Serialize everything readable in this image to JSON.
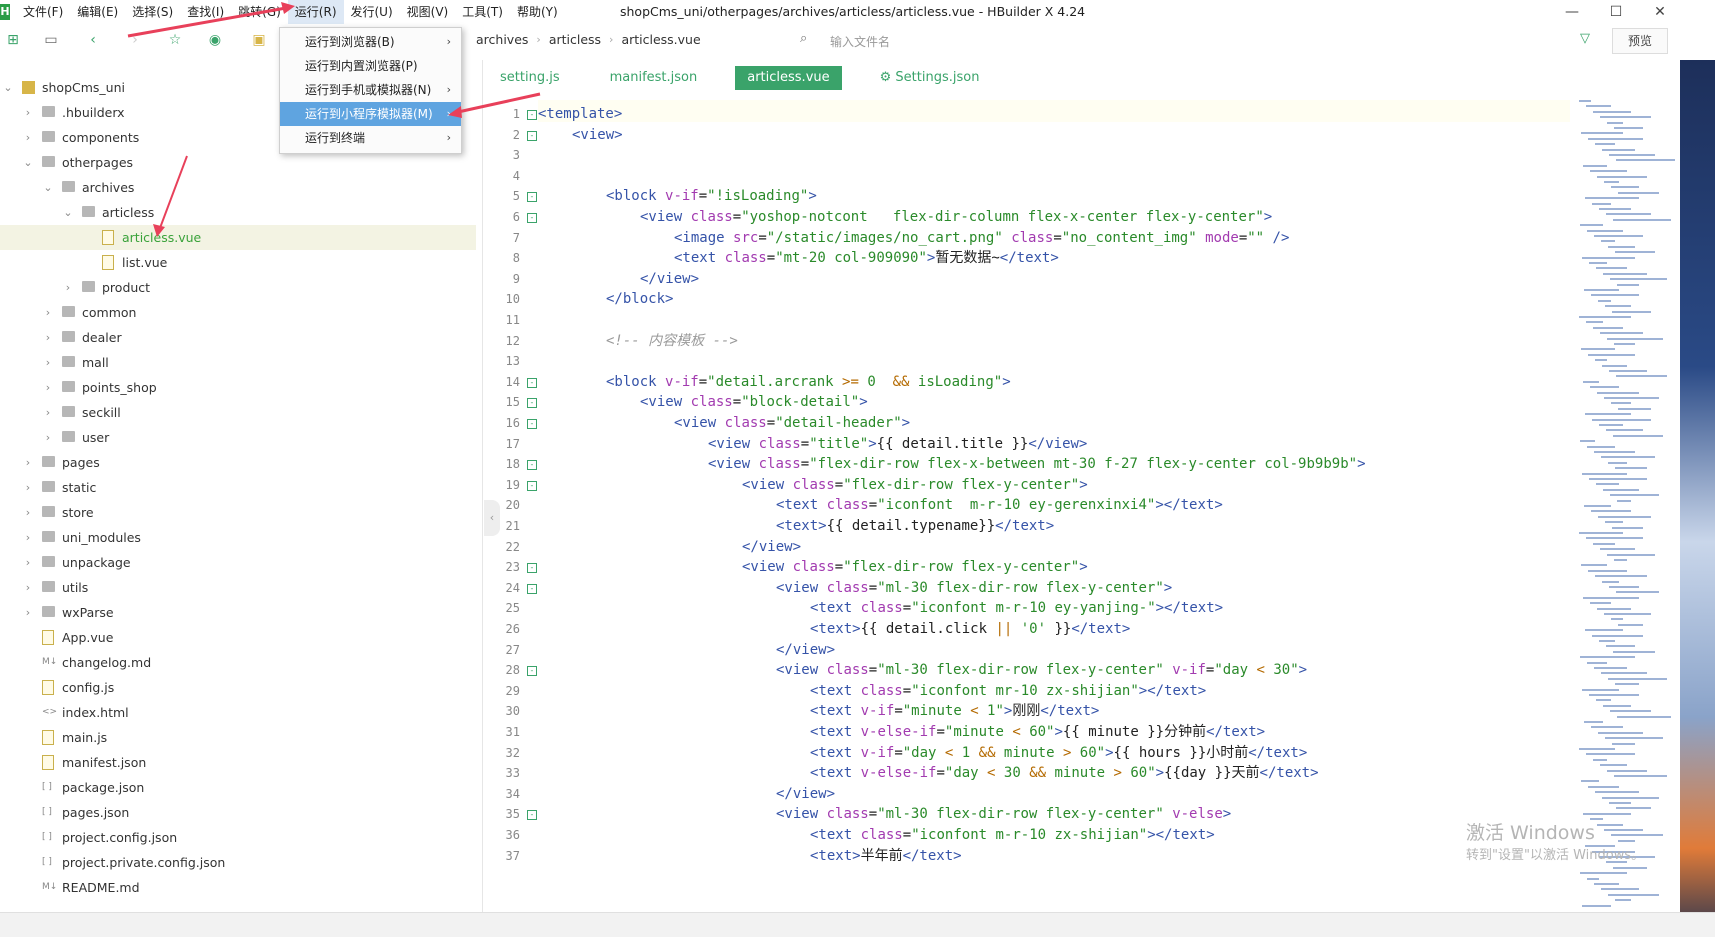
{
  "window": {
    "title": "shopCms_uni/otherpages/archives/articless/articless.vue - HBuilder X 4.24",
    "app_letter": "H"
  },
  "menu": [
    "文件(F)",
    "编辑(E)",
    "选择(S)",
    "查找(I)",
    "跳转(G)",
    "运行(R)",
    "发行(U)",
    "视图(V)",
    "工具(T)",
    "帮助(Y)"
  ],
  "run_menu": {
    "items": [
      {
        "label": "运行到浏览器(B)",
        "has_submenu": true
      },
      {
        "label": "运行到内置浏览器(P)",
        "has_submenu": false
      },
      {
        "label": "运行到手机或模拟器(N)",
        "has_submenu": true
      },
      {
        "label": "运行到小程序模拟器(M)",
        "has_submenu": true,
        "highlighted": true
      },
      {
        "label": "运行到终端",
        "has_submenu": true
      }
    ]
  },
  "breadcrumb": [
    "archives",
    "articless",
    "articless.vue"
  ],
  "file_search": {
    "placeholder": "输入文件名"
  },
  "preview_label": "预览",
  "tree": [
    {
      "label": "shopCms_uni",
      "depth": 0,
      "type": "root",
      "open": true
    },
    {
      "label": ".hbuilderx",
      "depth": 1,
      "type": "folder",
      "open": false
    },
    {
      "label": "components",
      "depth": 1,
      "type": "folder",
      "open": false
    },
    {
      "label": "otherpages",
      "depth": 1,
      "type": "folder",
      "open": true
    },
    {
      "label": "archives",
      "depth": 2,
      "type": "folder",
      "open": true
    },
    {
      "label": "articless",
      "depth": 3,
      "type": "folder",
      "open": true
    },
    {
      "label": "articless.vue",
      "depth": 4,
      "type": "file",
      "selected": true
    },
    {
      "label": "list.vue",
      "depth": 4,
      "type": "file"
    },
    {
      "label": "product",
      "depth": 3,
      "type": "folder",
      "open": false
    },
    {
      "label": "common",
      "depth": 2,
      "type": "folder",
      "open": false
    },
    {
      "label": "dealer",
      "depth": 2,
      "type": "folder",
      "open": false
    },
    {
      "label": "mall",
      "depth": 2,
      "type": "folder",
      "open": false
    },
    {
      "label": "points_shop",
      "depth": 2,
      "type": "folder",
      "open": false
    },
    {
      "label": "seckill",
      "depth": 2,
      "type": "folder",
      "open": false
    },
    {
      "label": "user",
      "depth": 2,
      "type": "folder",
      "open": false
    },
    {
      "label": "pages",
      "depth": 1,
      "type": "folder",
      "open": false
    },
    {
      "label": "static",
      "depth": 1,
      "type": "folder",
      "open": false
    },
    {
      "label": "store",
      "depth": 1,
      "type": "folder",
      "open": false
    },
    {
      "label": "uni_modules",
      "depth": 1,
      "type": "folder",
      "open": false
    },
    {
      "label": "unpackage",
      "depth": 1,
      "type": "folder",
      "open": false
    },
    {
      "label": "utils",
      "depth": 1,
      "type": "folder",
      "open": false
    },
    {
      "label": "wxParse",
      "depth": 1,
      "type": "folder",
      "open": false
    },
    {
      "label": "App.vue",
      "depth": 1,
      "type": "file"
    },
    {
      "label": "changelog.md",
      "depth": 1,
      "type": "md"
    },
    {
      "label": "config.js",
      "depth": 1,
      "type": "file"
    },
    {
      "label": "index.html",
      "depth": 1,
      "type": "html"
    },
    {
      "label": "main.js",
      "depth": 1,
      "type": "file"
    },
    {
      "label": "manifest.json",
      "depth": 1,
      "type": "file"
    },
    {
      "label": "package.json",
      "depth": 1,
      "type": "json"
    },
    {
      "label": "pages.json",
      "depth": 1,
      "type": "json"
    },
    {
      "label": "project.config.json",
      "depth": 1,
      "type": "json"
    },
    {
      "label": "project.private.config.json",
      "depth": 1,
      "type": "json"
    },
    {
      "label": "README.md",
      "depth": 1,
      "type": "md"
    }
  ],
  "tabs": [
    {
      "label": "setting.js",
      "active": false
    },
    {
      "label": "manifest.json",
      "active": false
    },
    {
      "label": "articless.vue",
      "active": true
    },
    {
      "label": "⚙ Settings.json",
      "active": false
    }
  ],
  "code": [
    {
      "n": 1,
      "fold": true,
      "ind": 0,
      "html": "<span class='t'>&lt;template&gt;</span>"
    },
    {
      "n": 2,
      "fold": true,
      "ind": 1,
      "html": "<span class='t'>&lt;view&gt;</span>"
    },
    {
      "n": 3,
      "fold": false,
      "ind": 0,
      "html": ""
    },
    {
      "n": 4,
      "fold": false,
      "ind": 0,
      "html": ""
    },
    {
      "n": 5,
      "fold": true,
      "ind": 2,
      "html": "<span class='t'>&lt;block</span> <span class='a'>v-if</span>=<span class='s'>\"!isLoading\"</span><span class='t'>&gt;</span>"
    },
    {
      "n": 6,
      "fold": true,
      "ind": 3,
      "html": "<span class='t'>&lt;view</span> <span class='a'>class</span>=<span class='s'>\"yoshop-notcont   flex-dir-column flex-x-center flex-y-center\"</span><span class='t'>&gt;</span>"
    },
    {
      "n": 7,
      "fold": false,
      "ind": 4,
      "html": "<span class='t'>&lt;image</span> <span class='a'>src</span>=<span class='s'>\"/static/images/no_cart.png\"</span> <span class='a'>class</span>=<span class='s'>\"no_content_img\"</span> <span class='a'>mode</span>=<span class='s'>\"\"</span> <span class='t'>/&gt;</span>"
    },
    {
      "n": 8,
      "fold": false,
      "ind": 4,
      "html": "<span class='t'>&lt;text</span> <span class='a'>class</span>=<span class='s'>\"mt-20 col-909090\"</span><span class='t'>&gt;</span>暂无数据~<span class='t'>&lt;/text&gt;</span>"
    },
    {
      "n": 9,
      "fold": false,
      "ind": 3,
      "html": "<span class='t'>&lt;/view&gt;</span>"
    },
    {
      "n": 10,
      "fold": false,
      "ind": 2,
      "html": "<span class='t'>&lt;/block&gt;</span>"
    },
    {
      "n": 11,
      "fold": false,
      "ind": 0,
      "html": ""
    },
    {
      "n": 12,
      "fold": false,
      "ind": 2,
      "html": "<span class='c'>&lt;!-- 内容模板 --&gt;</span>"
    },
    {
      "n": 13,
      "fold": false,
      "ind": 0,
      "html": ""
    },
    {
      "n": 14,
      "fold": true,
      "ind": 2,
      "html": "<span class='t'>&lt;block</span> <span class='a'>v-if</span>=<span class='s'>\"detail.arcrank </span><span class='o'>&gt;=</span><span class='s'> 0  </span><span class='o'>&amp;&amp;</span><span class='s'> isLoading\"</span><span class='t'>&gt;</span>"
    },
    {
      "n": 15,
      "fold": true,
      "ind": 3,
      "html": "<span class='t'>&lt;view</span> <span class='a'>class</span>=<span class='s'>\"block-detail\"</span><span class='t'>&gt;</span>"
    },
    {
      "n": 16,
      "fold": true,
      "ind": 4,
      "html": "<span class='t'>&lt;view</span> <span class='a'>class</span>=<span class='s'>\"detail-header\"</span><span class='t'>&gt;</span>"
    },
    {
      "n": 17,
      "fold": false,
      "ind": 5,
      "html": "<span class='t'>&lt;view</span> <span class='a'>class</span>=<span class='s'>\"title\"</span><span class='t'>&gt;</span>{{ detail.title }}<span class='t'>&lt;/view&gt;</span>"
    },
    {
      "n": 18,
      "fold": true,
      "ind": 5,
      "html": "<span class='t'>&lt;view</span> <span class='a'>class</span>=<span class='s'>\"flex-dir-row flex-x-between mt-30 f-27 flex-y-center col-9b9b9b\"</span><span class='t'>&gt;</span>"
    },
    {
      "n": 19,
      "fold": true,
      "ind": 6,
      "html": "<span class='t'>&lt;view</span> <span class='a'>class</span>=<span class='s'>\"flex-dir-row flex-y-center\"</span><span class='t'>&gt;</span>"
    },
    {
      "n": 20,
      "fold": false,
      "ind": 7,
      "html": "<span class='t'>&lt;text</span> <span class='a'>class</span>=<span class='s'>\"iconfont  m-r-10 ey-gerenxinxi4\"</span><span class='t'>&gt;&lt;/text&gt;</span>"
    },
    {
      "n": 21,
      "fold": false,
      "ind": 7,
      "html": "<span class='t'>&lt;text&gt;</span>{{ detail.typename}}<span class='t'>&lt;/text&gt;</span>"
    },
    {
      "n": 22,
      "fold": false,
      "ind": 6,
      "html": "<span class='t'>&lt;/view&gt;</span>"
    },
    {
      "n": 23,
      "fold": true,
      "ind": 6,
      "html": "<span class='t'>&lt;view</span> <span class='a'>class</span>=<span class='s'>\"flex-dir-row flex-y-center\"</span><span class='t'>&gt;</span>"
    },
    {
      "n": 24,
      "fold": true,
      "ind": 7,
      "html": "<span class='t'>&lt;view</span> <span class='a'>class</span>=<span class='s'>\"ml-30 flex-dir-row flex-y-center\"</span><span class='t'>&gt;</span>"
    },
    {
      "n": 25,
      "fold": false,
      "ind": 8,
      "html": "<span class='t'>&lt;text</span> <span class='a'>class</span>=<span class='s'>\"iconfont m-r-10 ey-yanjing-\"</span><span class='t'>&gt;&lt;/text&gt;</span>"
    },
    {
      "n": 26,
      "fold": false,
      "ind": 8,
      "html": "<span class='t'>&lt;text&gt;</span>{{ detail.click <span class='o'>||</span> <span class='s'>'0'</span> }}<span class='t'>&lt;/text&gt;</span>"
    },
    {
      "n": 27,
      "fold": false,
      "ind": 7,
      "html": "<span class='t'>&lt;/view&gt;</span>"
    },
    {
      "n": 28,
      "fold": true,
      "ind": 7,
      "html": "<span class='t'>&lt;view</span> <span class='a'>class</span>=<span class='s'>\"ml-30 flex-dir-row flex-y-center\"</span> <span class='a'>v-if</span>=<span class='s'>\"day </span><span class='o'>&lt;</span><span class='s'> 30\"</span><span class='t'>&gt;</span>"
    },
    {
      "n": 29,
      "fold": false,
      "ind": 8,
      "html": "<span class='t'>&lt;text</span> <span class='a'>class</span>=<span class='s'>\"iconfont mr-10 zx-shijian\"</span><span class='t'>&gt;&lt;/text&gt;</span>"
    },
    {
      "n": 30,
      "fold": false,
      "ind": 8,
      "html": "<span class='t'>&lt;text</span> <span class='a'>v-if</span>=<span class='s'>\"minute </span><span class='o'>&lt;</span><span class='s'> 1\"</span><span class='t'>&gt;</span>刚刚<span class='t'>&lt;/text&gt;</span>"
    },
    {
      "n": 31,
      "fold": false,
      "ind": 8,
      "html": "<span class='t'>&lt;text</span> <span class='a'>v-else-if</span>=<span class='s'>\"minute </span><span class='o'>&lt;</span><span class='s'> 60\"</span><span class='t'>&gt;</span>{{ minute }}分钟前<span class='t'>&lt;/text&gt;</span>"
    },
    {
      "n": 32,
      "fold": false,
      "ind": 8,
      "html": "<span class='t'>&lt;text</span> <span class='a'>v-if</span>=<span class='s'>\"day </span><span class='o'>&lt;</span><span class='s'> 1 </span><span class='o'>&amp;&amp;</span><span class='s'> minute </span><span class='o'>&gt;</span><span class='s'> 60\"</span><span class='t'>&gt;</span>{{ hours }}小时前<span class='t'>&lt;/text&gt;</span>"
    },
    {
      "n": 33,
      "fold": false,
      "ind": 8,
      "html": "<span class='t'>&lt;text</span> <span class='a'>v-else-if</span>=<span class='s'>\"day </span><span class='o'>&lt;</span><span class='s'> 30 </span><span class='o'>&amp;&amp;</span><span class='s'> minute </span><span class='o'>&gt;</span><span class='s'> 60\"</span><span class='t'>&gt;</span>{{day }}天前<span class='t'>&lt;/text&gt;</span>"
    },
    {
      "n": 34,
      "fold": false,
      "ind": 7,
      "html": "<span class='t'>&lt;/view&gt;</span>"
    },
    {
      "n": 35,
      "fold": true,
      "ind": 7,
      "html": "<span class='t'>&lt;view</span> <span class='a'>class</span>=<span class='s'>\"ml-30 flex-dir-row flex-y-center\"</span> <span class='a'>v-else</span><span class='t'>&gt;</span>"
    },
    {
      "n": 36,
      "fold": false,
      "ind": 8,
      "html": "<span class='t'>&lt;text</span> <span class='a'>class</span>=<span class='s'>\"iconfont m-r-10 zx-shijian\"</span><span class='t'>&gt;&lt;/text&gt;</span>"
    },
    {
      "n": 37,
      "fold": false,
      "ind": 8,
      "html": "<span class='t'>&lt;text&gt;</span>半年前<span class='t'>&lt;/text&gt;</span>"
    }
  ],
  "watermark": {
    "line1": "激活 Windows",
    "line2": "转到\"设置\"以激活 Windows。"
  },
  "colors": {
    "accent": "#3aa36a",
    "menu_highlight": "#5fa4e0",
    "arrow": "#e8405a"
  }
}
